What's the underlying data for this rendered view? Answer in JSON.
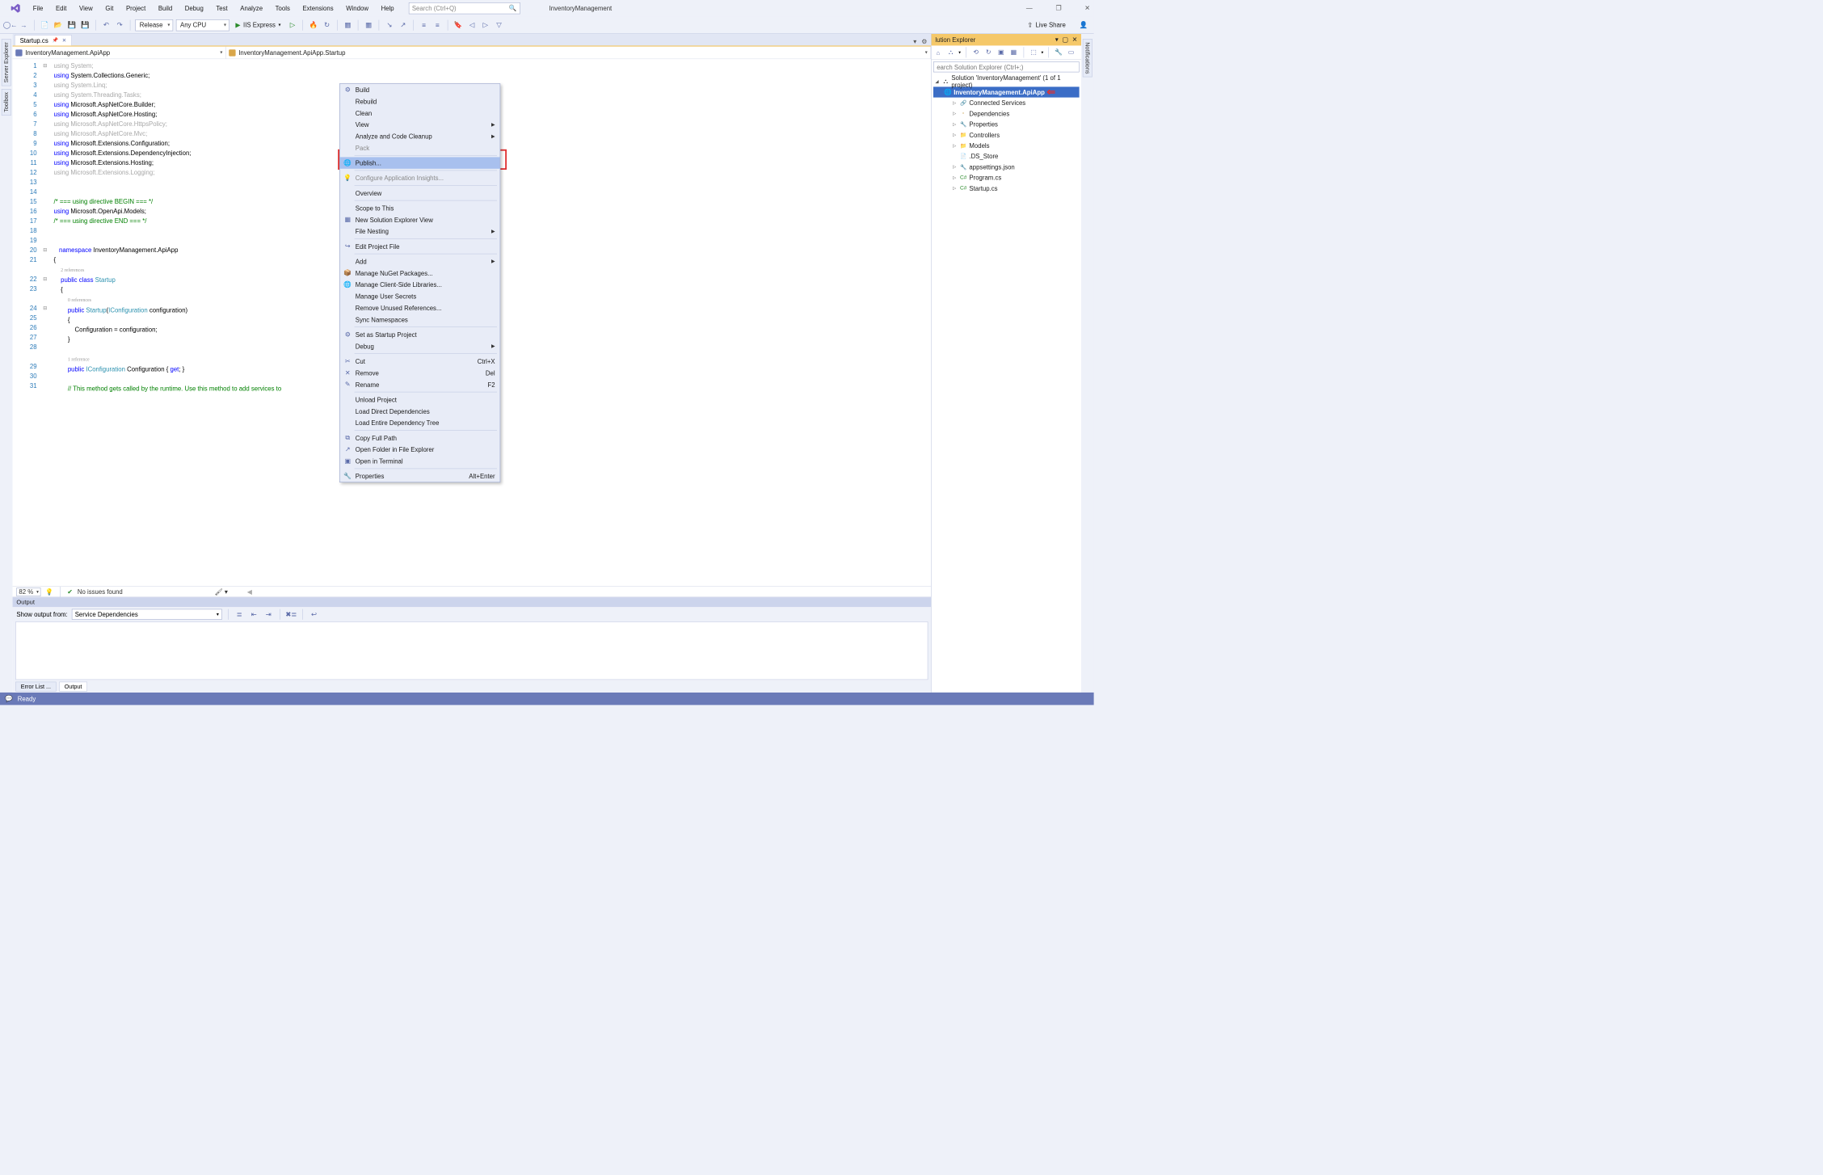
{
  "title": {
    "solution": "InventoryManagement"
  },
  "menu": [
    "File",
    "Edit",
    "View",
    "Git",
    "Project",
    "Build",
    "Debug",
    "Test",
    "Analyze",
    "Tools",
    "Extensions",
    "Window",
    "Help"
  ],
  "search": {
    "placeholder": "Search (Ctrl+Q)"
  },
  "win_controls": {
    "min": "—",
    "max": "❐",
    "close": "✕"
  },
  "toolbar": {
    "config": "Release",
    "platform": "Any CPU",
    "run_target": "IIS Express",
    "live_share": "Live Share"
  },
  "left_tabs": [
    "Server Explorer",
    "Toolbox"
  ],
  "right_tabs": [
    "Notifications"
  ],
  "doc_tab": {
    "name": "Startup.cs"
  },
  "nav": {
    "left": "InventoryManagement.ApiApp",
    "mid": "InventoryManagement.ApiApp.Startup"
  },
  "code_lines": [
    {
      "n": 1,
      "html": "<span class='gray'>using</span> <span class='gray'>System;</span>"
    },
    {
      "n": 2,
      "html": "<span class='kw'>using</span> System.Collections.Generic;"
    },
    {
      "n": 3,
      "html": "<span class='gray'>using</span> <span class='gray'>System.Linq;</span>"
    },
    {
      "n": 4,
      "html": "<span class='gray'>using</span> <span class='gray'>System.Threading.Tasks;</span>"
    },
    {
      "n": 5,
      "html": "<span class='kw'>using</span> Microsoft.AspNetCore.Builder;"
    },
    {
      "n": 6,
      "html": "<span class='kw'>using</span> Microsoft.AspNetCore.Hosting;"
    },
    {
      "n": 7,
      "html": "<span class='gray'>using</span> <span class='gray'>Microsoft.AspNetCore.HttpsPolicy;</span>"
    },
    {
      "n": 8,
      "html": "<span class='gray'>using</span> <span class='gray'>Microsoft.AspNetCore.Mvc;</span>"
    },
    {
      "n": 9,
      "html": "<span class='kw'>using</span> Microsoft.Extensions.Configuration;"
    },
    {
      "n": 10,
      "html": "<span class='kw'>using</span> Microsoft.Extensions.DependencyInjection;"
    },
    {
      "n": 11,
      "html": "<span class='kw'>using</span> Microsoft.Extensions.Hosting;"
    },
    {
      "n": 12,
      "html": "<span class='gray'>using</span> <span class='gray'>Microsoft.Extensions.Logging;</span>"
    },
    {
      "n": 13,
      "html": ""
    },
    {
      "n": 14,
      "html": ""
    },
    {
      "n": 15,
      "html": "<span class='com'>/* === using directive BEGIN === */</span>"
    },
    {
      "n": 16,
      "html": "<span class='kw'>using</span> Microsoft.OpenApi.Models;"
    },
    {
      "n": 17,
      "html": "<span class='com'>/* === using directive END === */</span>"
    },
    {
      "n": 18,
      "html": ""
    },
    {
      "n": 19,
      "html": ""
    },
    {
      "n": 20,
      "html": "   <span class='kw'>namespace</span> InventoryManagement.ApiApp"
    },
    {
      "n": 21,
      "html": "{"
    },
    {
      "n": "",
      "html": "    <span class='ref-lens'>2 references</span>"
    },
    {
      "n": 22,
      "html": "    <span class='kw'>public</span> <span class='kw'>class</span> <span class='type'>Startup</span>"
    },
    {
      "n": 23,
      "html": "    {"
    },
    {
      "n": "",
      "html": "        <span class='ref-lens'>0 references</span>"
    },
    {
      "n": 24,
      "html": "        <span class='kw'>public</span> <span class='type'>Startup</span>(<span class='type'>IConfiguration</span> configuration)"
    },
    {
      "n": 25,
      "html": "        {"
    },
    {
      "n": 26,
      "html": "            Configuration = configuration;"
    },
    {
      "n": 27,
      "html": "        }"
    },
    {
      "n": 28,
      "html": ""
    },
    {
      "n": "",
      "html": "        <span class='ref-lens'>1 reference</span>"
    },
    {
      "n": 29,
      "html": "        <span class='kw'>public</span> <span class='type'>IConfiguration</span> Configuration { <span class='kw'>get</span>; }"
    },
    {
      "n": 30,
      "html": ""
    },
    {
      "n": 31,
      "html": "        <span class='com'>// This method gets called by the runtime. Use this method to add services to</span>"
    }
  ],
  "editor_status": {
    "zoom": "82 %",
    "health": "No issues found"
  },
  "output": {
    "title": "Output",
    "from_label": "Show output from:",
    "from_value": "Service Dependencies",
    "tabs": {
      "error": "Error List ...",
      "output": "Output"
    }
  },
  "statusbar": {
    "ready": "Ready"
  },
  "sln": {
    "title": "lution Explorer",
    "search_placeholder": "earch Solution Explorer (Ctrl+;)",
    "root": "Solution 'InventoryManagement' (1 of 1 project)",
    "project": "InventoryManagement.ApiApp",
    "nodes": [
      {
        "label": "Connected Services",
        "ico": "🔗"
      },
      {
        "label": "Dependencies",
        "ico": "▫"
      },
      {
        "label": "Properties",
        "ico": "🔧"
      },
      {
        "label": "Controllers",
        "ico": "📁"
      },
      {
        "label": "Models",
        "ico": "📁"
      },
      {
        "label": ".DS_Store",
        "ico": "📄",
        "noexp": true
      },
      {
        "label": "appsettings.json",
        "ico": "🔧"
      },
      {
        "label": "Program.cs",
        "ico": "C#"
      },
      {
        "label": "Startup.cs",
        "ico": "C#"
      }
    ]
  },
  "context_menu": [
    {
      "label": "Build",
      "ico": "⚙"
    },
    {
      "label": "Rebuild"
    },
    {
      "label": "Clean"
    },
    {
      "label": "View",
      "sub": true
    },
    {
      "label": "Analyze and Code Cleanup",
      "sub": true
    },
    {
      "label": "Pack",
      "covered": true
    },
    {
      "sep": true
    },
    {
      "label": "Publish...",
      "ico": "🌐",
      "highlight": true
    },
    {
      "sep": true
    },
    {
      "label": "Configure Application Insights...",
      "ico": "💡",
      "covered": true
    },
    {
      "sep": true
    },
    {
      "label": "Overview"
    },
    {
      "sep": true
    },
    {
      "label": "Scope to This"
    },
    {
      "label": "New Solution Explorer View",
      "ico": "▦"
    },
    {
      "label": "File Nesting",
      "sub": true
    },
    {
      "sep": true
    },
    {
      "label": "Edit Project File",
      "ico": "↪"
    },
    {
      "sep": true
    },
    {
      "label": "Add",
      "sub": true
    },
    {
      "label": "Manage NuGet Packages...",
      "ico": "📦"
    },
    {
      "label": "Manage Client-Side Libraries...",
      "ico": "🌐"
    },
    {
      "label": "Manage User Secrets"
    },
    {
      "label": "Remove Unused References..."
    },
    {
      "label": "Sync Namespaces"
    },
    {
      "sep": true
    },
    {
      "label": "Set as Startup Project",
      "ico": "⚙"
    },
    {
      "label": "Debug",
      "sub": true
    },
    {
      "sep": true
    },
    {
      "label": "Cut",
      "ico": "✂",
      "shortcut": "Ctrl+X"
    },
    {
      "label": "Remove",
      "ico": "✕",
      "shortcut": "Del"
    },
    {
      "label": "Rename",
      "ico": "✎",
      "shortcut": "F2"
    },
    {
      "sep": true
    },
    {
      "label": "Unload Project"
    },
    {
      "label": "Load Direct Dependencies"
    },
    {
      "label": "Load Entire Dependency Tree"
    },
    {
      "sep": true
    },
    {
      "label": "Copy Full Path",
      "ico": "⧉"
    },
    {
      "label": "Open Folder in File Explorer",
      "ico": "↗"
    },
    {
      "label": "Open in Terminal",
      "ico": "▣"
    },
    {
      "sep": true
    },
    {
      "label": "Properties",
      "ico": "🔧",
      "shortcut": "Alt+Enter"
    }
  ]
}
